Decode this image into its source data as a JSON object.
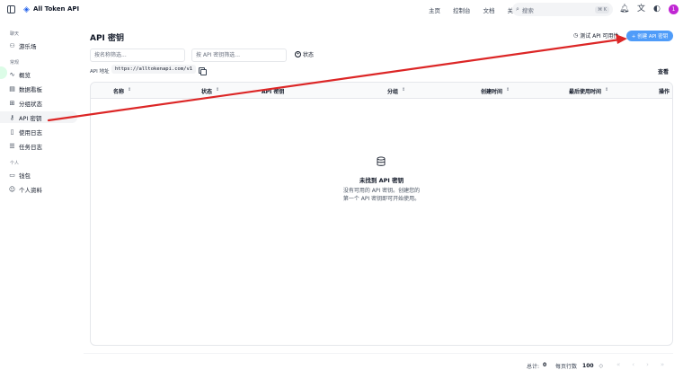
{
  "app": {
    "title": "All Token API"
  },
  "nav": {
    "items": [
      "主页",
      "控制台",
      "文档",
      "关于"
    ]
  },
  "search": {
    "placeholder": "搜索",
    "shortcut": "⌘ K"
  },
  "user": {
    "avatar_letter": "1"
  },
  "sidebar": {
    "sections": [
      {
        "label": "聊天",
        "items": [
          {
            "label": "游乐场",
            "icon": "shapes-icon"
          }
        ]
      },
      {
        "label": "常规",
        "items": [
          {
            "label": "概览",
            "icon": "activity-icon"
          },
          {
            "label": "数据看板",
            "icon": "dashboard-icon"
          },
          {
            "label": "分组状态",
            "icon": "grid-icon"
          },
          {
            "label": "API 密钥",
            "icon": "key-icon"
          },
          {
            "label": "使用日志",
            "icon": "file-icon"
          },
          {
            "label": "任务日志",
            "icon": "list-icon"
          }
        ]
      },
      {
        "label": "个人",
        "items": [
          {
            "label": "钱包",
            "icon": "wallet-icon"
          },
          {
            "label": "个人资料",
            "icon": "user-icon"
          }
        ]
      }
    ]
  },
  "page": {
    "title": "API 密钥",
    "test_button": "测试 API 可用性",
    "create_button": "+ 创建 API 密钥",
    "filter_name_placeholder": "按名称筛选...",
    "filter_key_placeholder": "按 API 密钥筛选...",
    "status_filter": "状态",
    "api_address_label": "API 地址",
    "api_address": "https://alltokenapi.com/v1",
    "view_button": "查看"
  },
  "table": {
    "columns": [
      "名称",
      "状态",
      "API 密钥",
      "分组",
      "创建时间",
      "最后使用时间",
      "操作"
    ],
    "rows": [],
    "empty_title": "未找到 API 密钥",
    "empty_desc_line1": "没有可用的 API 密钥。创建您的",
    "empty_desc_line2": "第一个 API 密钥即可开始使用。"
  },
  "pagination": {
    "total_label": "总计:",
    "total": "0",
    "rows_label": "每页行数",
    "rows_per_page": "100"
  },
  "colors": {
    "accent": "#4f9cf9",
    "arrow": "#dc2626"
  }
}
